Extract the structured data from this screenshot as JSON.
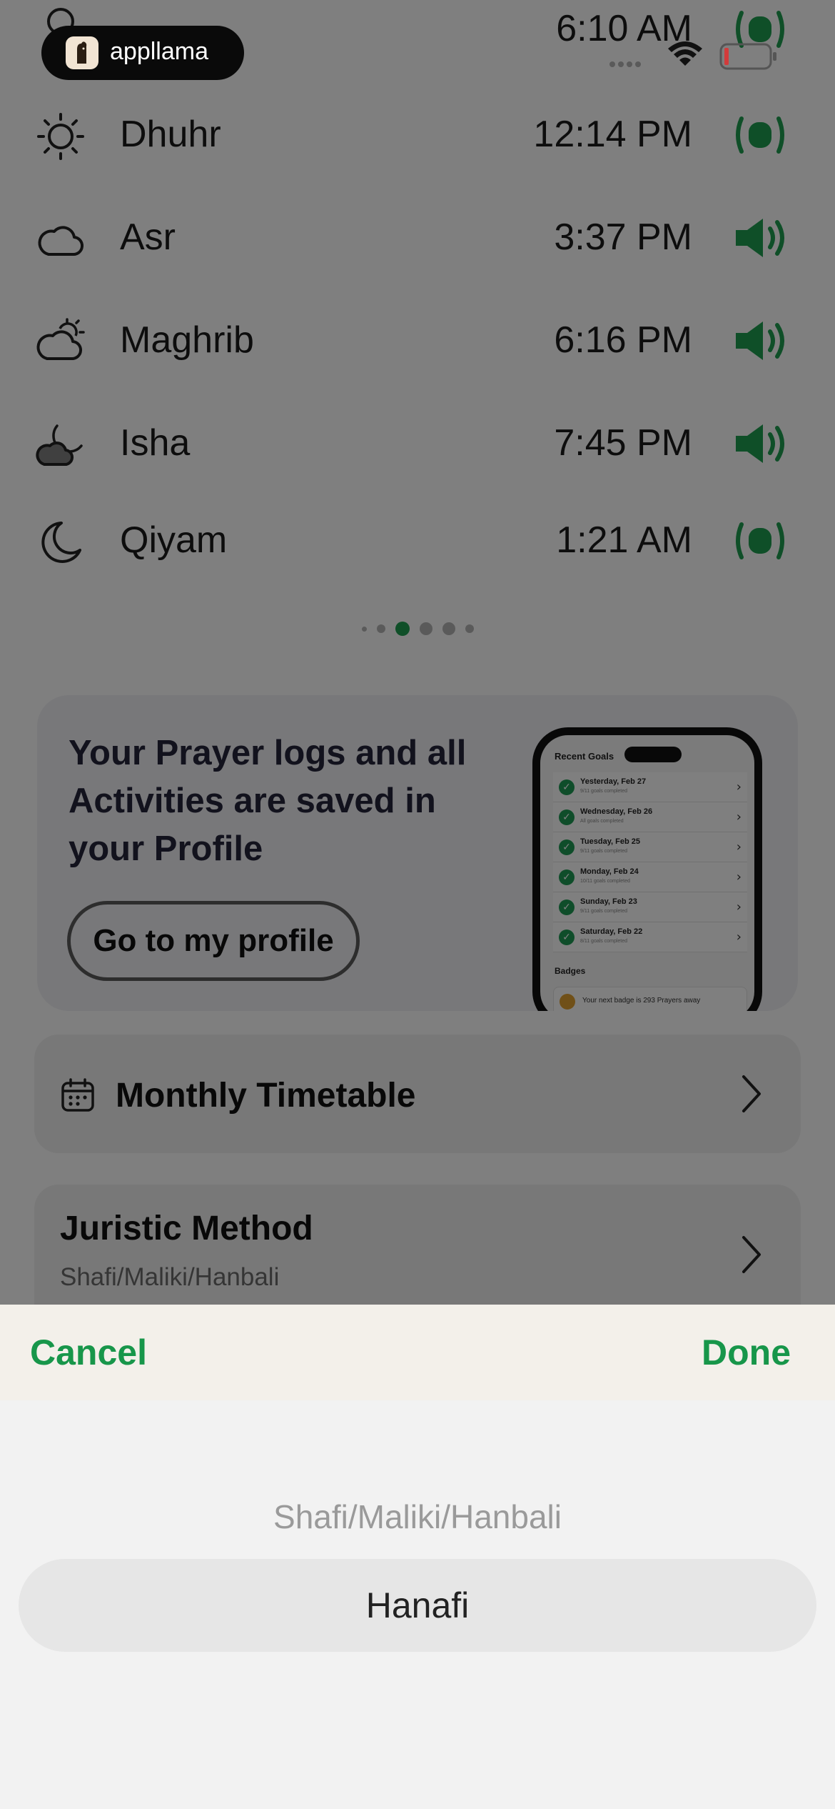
{
  "status_bar": {
    "time_partial": "6:10 AM",
    "app_badge_label": "appllama"
  },
  "prayers": [
    {
      "name": "Dhuhr",
      "time": "12:14 PM",
      "icon": "sun-icon",
      "alert": "vibrate-icon"
    },
    {
      "name": "Asr",
      "time": "3:37 PM",
      "icon": "cloud-icon",
      "alert": "speaker-icon"
    },
    {
      "name": "Maghrib",
      "time": "6:16 PM",
      "icon": "cloud-sun-icon",
      "alert": "speaker-icon"
    },
    {
      "name": "Isha",
      "time": "7:45 PM",
      "icon": "cloud-moon-icon",
      "alert": "speaker-icon"
    },
    {
      "name": "Qiyam",
      "time": "1:21 AM",
      "icon": "moon-icon",
      "alert": "vibrate-icon"
    }
  ],
  "pagination": {
    "count": 6,
    "active_index": 2
  },
  "profile_card": {
    "headline": "Your Prayer logs and all Activities are saved in your Profile",
    "button_label": "Go to my profile",
    "preview": {
      "recent_goals_title": "Recent Goals",
      "goals": [
        {
          "date": "Yesterday, Feb 27",
          "sub": "9/11 goals completed"
        },
        {
          "date": "Wednesday, Feb 26",
          "sub": "All goals completed"
        },
        {
          "date": "Tuesday, Feb 25",
          "sub": "9/11 goals completed"
        },
        {
          "date": "Monday, Feb 24",
          "sub": "10/11 goals completed"
        },
        {
          "date": "Sunday, Feb 23",
          "sub": "9/11 goals completed"
        },
        {
          "date": "Saturday, Feb 22",
          "sub": "8/11 goals completed"
        }
      ],
      "badges_title": "Badges",
      "badge_text": "Your next badge is 293 Prayers away"
    }
  },
  "monthly_timetable": {
    "label": "Monthly Timetable"
  },
  "juristic_method": {
    "title": "Juristic Method",
    "value": "Shafi/Maliki/Hanbali"
  },
  "picker": {
    "cancel_label": "Cancel",
    "done_label": "Done",
    "options": [
      "Shafi/Maliki/Hanbali",
      "Hanafi"
    ],
    "selected": "Hanafi"
  },
  "colors": {
    "accent_green": "#17964a"
  }
}
